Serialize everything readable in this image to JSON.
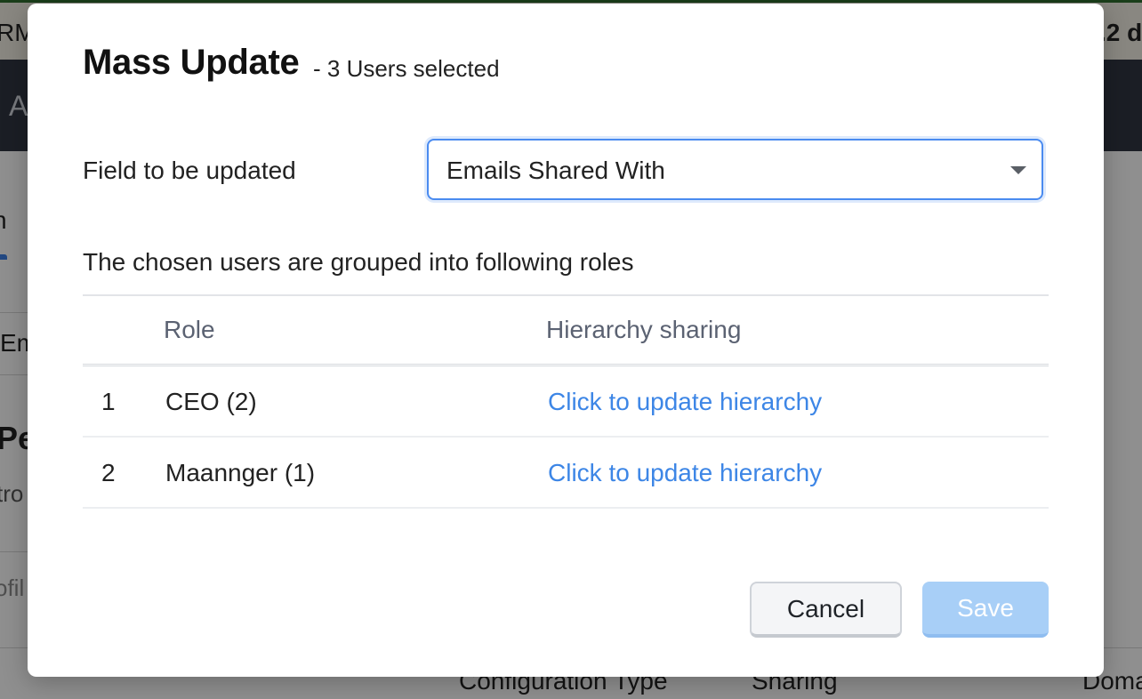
{
  "background": {
    "header_left_text": "RM",
    "header_right_text": ".2 d",
    "nav_letter": "A",
    "side_texts": [
      "n",
      "Em",
      "Pe",
      "tro",
      "ofil"
    ],
    "bottom_columns": [
      "Configuration Type",
      "Sharing",
      "Doma"
    ]
  },
  "modal": {
    "title": "Mass Update",
    "subtitle": "- 3 Users selected",
    "field_label": "Field to be updated",
    "select_value": "Emails Shared With",
    "group_text": "The chosen users are grouped into following roles",
    "table": {
      "headers": {
        "role": "Role",
        "hierarchy": "Hierarchy sharing"
      },
      "rows": [
        {
          "index": "1",
          "role": "CEO (2)",
          "link": "Click to update hierarchy"
        },
        {
          "index": "2",
          "role": "Maannger (1)",
          "link": "Click to update hierarchy"
        }
      ]
    },
    "buttons": {
      "cancel": "Cancel",
      "save": "Save"
    }
  },
  "colors": {
    "accent_blue": "#3d86e6",
    "select_border": "#4a8bf0",
    "save_disabled": "#a8cff7"
  }
}
